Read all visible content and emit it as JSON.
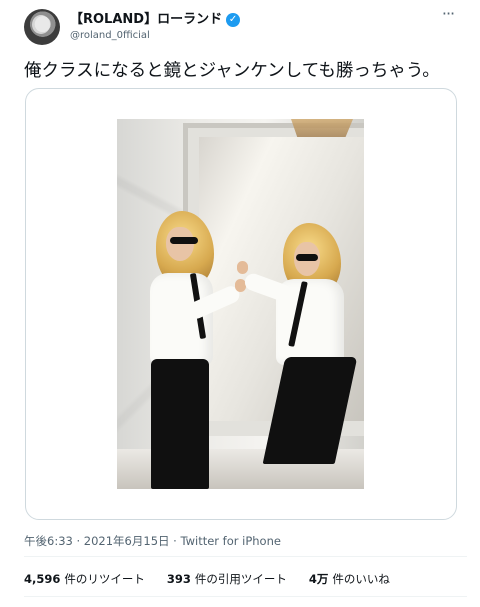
{
  "tweet": {
    "author": {
      "display_name": "【ROLAND】ローランド",
      "handle": "@roland_0fficial",
      "verified_icon": "✓"
    },
    "more_icon": "···",
    "text": "俺クラスになると鏡とジャンケンしても勝っちゃう。",
    "meta": "午後6:33 · 2021年6月15日 · Twitter for iPhone",
    "stats": [
      {
        "number": "4,596",
        "label": "件のリツイート"
      },
      {
        "number": "393",
        "label": "件の引用ツイート"
      },
      {
        "number": "4万",
        "label": "件のいいね"
      }
    ]
  }
}
